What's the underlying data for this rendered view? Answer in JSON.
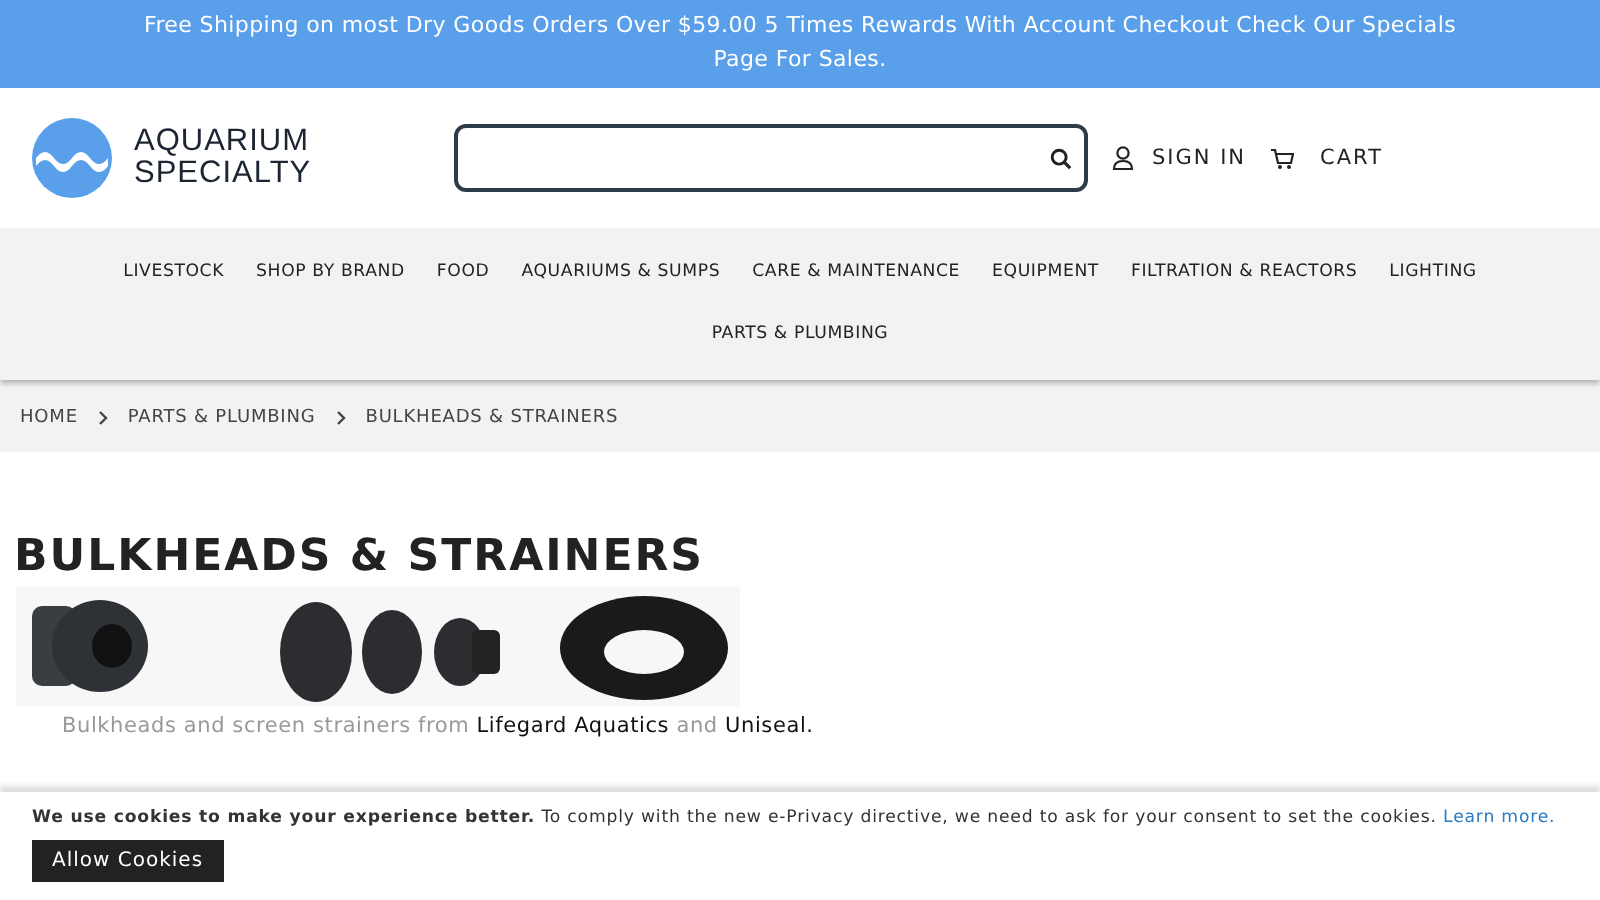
{
  "promo_banner": "Free Shipping on most Dry Goods Orders Over $59.00 5 Times Rewards With Account Checkout Check Our Specials Page For Sales.",
  "header": {
    "logo_text": [
      "AQUARIUM",
      "SPECIALTY"
    ],
    "account_link": "SIGN IN",
    "cart_link": "CART"
  },
  "nav": [
    {
      "label": "LIVESTOCK"
    },
    {
      "label": "SHOP BY BRAND"
    },
    {
      "label": "FOOD"
    },
    {
      "label": "AQUARIUMS & SUMPS"
    },
    {
      "label": "CARE & MAINTENANCE"
    },
    {
      "label": "EQUIPMENT"
    },
    {
      "label": "FILTRATION & REACTORS"
    },
    {
      "label": "LIGHTING"
    },
    {
      "label": "PARTS & PLUMBING"
    }
  ],
  "breadcrumbs": [
    "HOME",
    "PARTS & PLUMBING",
    "BULKHEADS & STRAINERS"
  ],
  "page_title": "BULKHEADS & STRAINERS",
  "description": "Bulkheads and screen strainers from **Lifegard Aquatics** and **Uniseal.**",
  "cookie_notice": {
    "text": "**We use cookies to make your experience better.** To comply with the new e-Privacy directive, we need to ask for your consent to set the cookies.",
    "link": "Learn more.",
    "button": "Allow Cookies"
  }
}
